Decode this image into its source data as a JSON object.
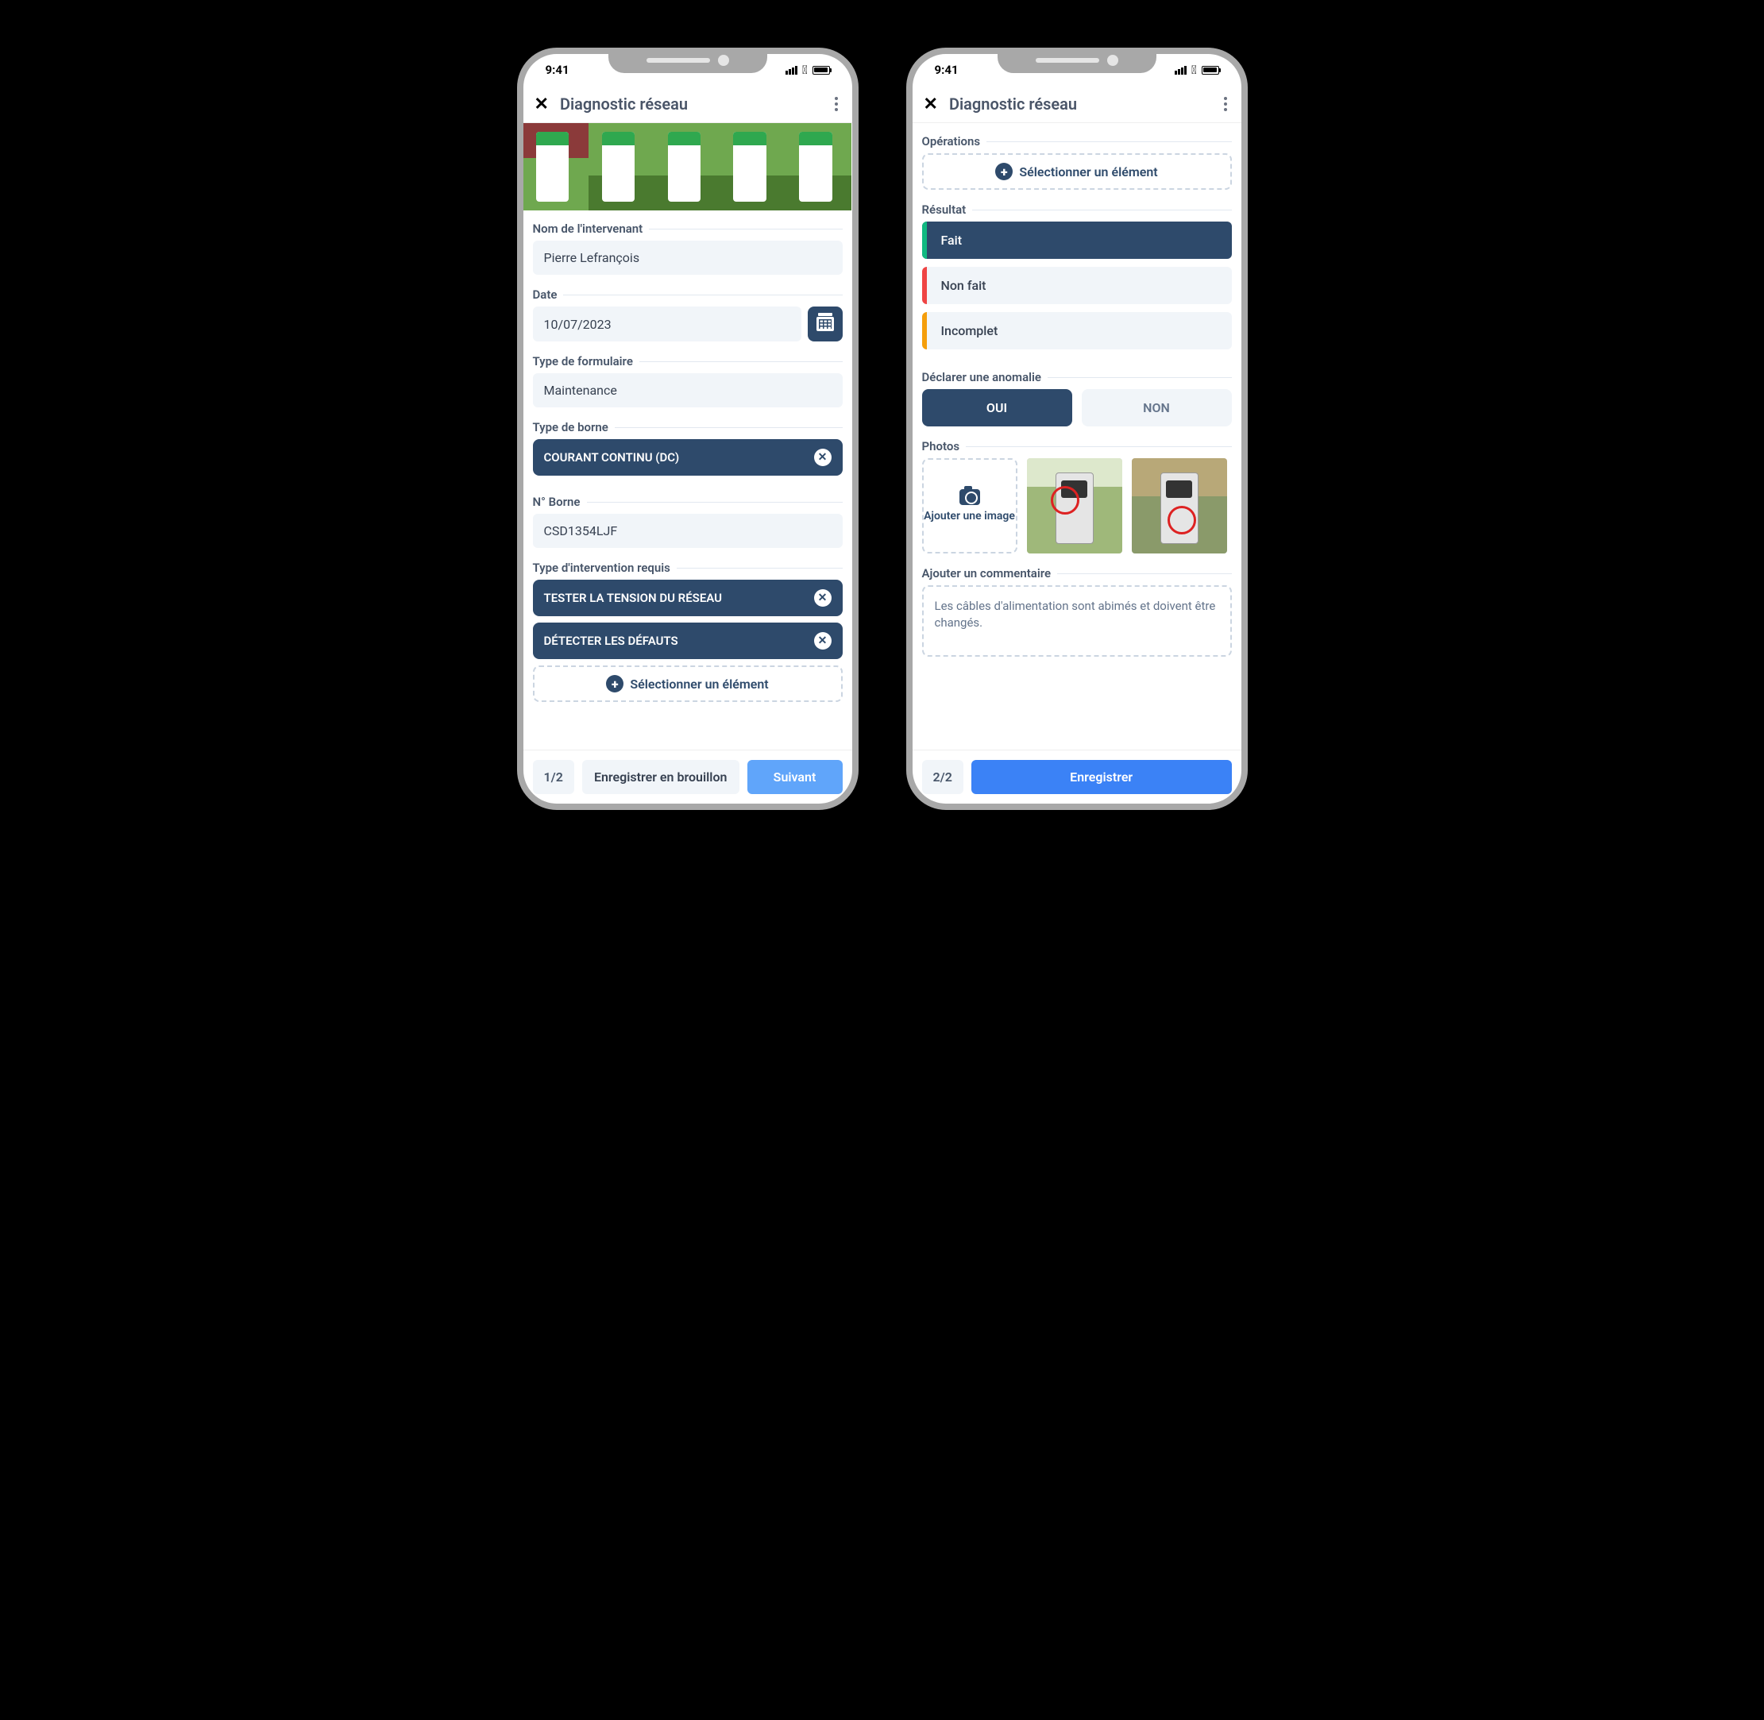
{
  "status": {
    "time": "9:41"
  },
  "header": {
    "title": "Diagnostic réseau"
  },
  "screen1": {
    "fields": {
      "intervenant": {
        "label": "Nom de l'intervenant",
        "value": "Pierre Lefrançois"
      },
      "date": {
        "label": "Date",
        "value": "10/07/2023"
      },
      "formType": {
        "label": "Type de formulaire",
        "value": "Maintenance"
      },
      "borneType": {
        "label": "Type de borne"
      },
      "borneNum": {
        "label": "N° Borne",
        "value": "CSD1354LJF"
      },
      "intervType": {
        "label": "Type d'intervention requis"
      }
    },
    "borneTypeChip": "COURANT CONTINU (DC)",
    "interventionChips": [
      "TESTER LA TENSION DU RÉSEAU",
      "DÉTECTER LES DÉFAUTS"
    ],
    "selectLabel": "Sélectionner un élément",
    "footer": {
      "page": "1/2",
      "draft": "Enregistrer en brouillon",
      "next": "Suivant"
    }
  },
  "screen2": {
    "operations": {
      "label": "Opérations",
      "selectLabel": "Sélectionner un élément"
    },
    "result": {
      "label": "Résultat",
      "options": [
        {
          "text": "Fait",
          "edge": "#10b981",
          "selected": true
        },
        {
          "text": "Non fait",
          "edge": "#ef4444",
          "selected": false
        },
        {
          "text": "Incomplet",
          "edge": "#f59e0b",
          "selected": false
        }
      ]
    },
    "anomaly": {
      "label": "Déclarer une anomalie",
      "yes": "OUI",
      "no": "NON",
      "selected": "yes"
    },
    "photos": {
      "label": "Photos",
      "addLabel": "Ajouter une image"
    },
    "comment": {
      "label": "Ajouter un commentaire",
      "value": "Les câbles d'alimentation sont abimés et doivent être changés."
    },
    "footer": {
      "page": "2/2",
      "save": "Enregistrer"
    }
  }
}
